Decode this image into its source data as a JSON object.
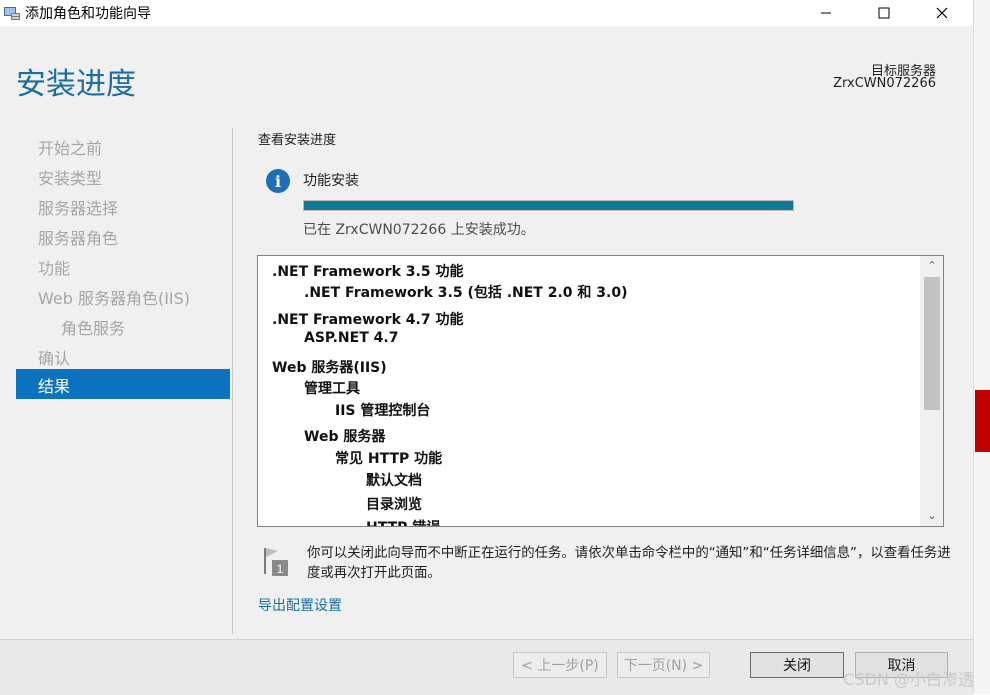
{
  "window": {
    "title": "添加角色和功能向导",
    "controls": [
      "minimize",
      "maximize",
      "close"
    ]
  },
  "header": {
    "page_title": "安装进度",
    "target_label": "目标服务器",
    "target_name": "ZrxCWN072266"
  },
  "nav": {
    "items": [
      {
        "label": "开始之前"
      },
      {
        "label": "安装类型"
      },
      {
        "label": "服务器选择"
      },
      {
        "label": "服务器角色"
      },
      {
        "label": "功能"
      },
      {
        "label": "Web 服务器角色(IIS)"
      },
      {
        "label": "角色服务"
      },
      {
        "label": "确认"
      },
      {
        "label": "结果"
      }
    ],
    "active_index": 8
  },
  "main": {
    "section_title": "查看安装进度",
    "feature_label": "功能安装",
    "progress_fraction": 1.0,
    "status_text": "已在 ZrxCWN072266 上安装成功。",
    "results": [
      {
        "text": ".NET Framework 3.5 功能",
        "level": 0
      },
      {
        "text": ".NET Framework 3.5 (包括 .NET 2.0 和 3.0)",
        "level": 1
      },
      {
        "text": ".NET Framework 4.7 功能",
        "level": 0
      },
      {
        "text": "ASP.NET 4.7",
        "level": 1
      },
      {
        "text": "Web 服务器(IIS)",
        "level": 0
      },
      {
        "text": "管理工具",
        "level": 1
      },
      {
        "text": "IIS 管理控制台",
        "level": 2
      },
      {
        "text": "Web 服务器",
        "level": 1
      },
      {
        "text": "常见 HTTP 功能",
        "level": 2
      },
      {
        "text": "默认文档",
        "level": 3
      },
      {
        "text": "目录浏览",
        "level": 3
      },
      {
        "text": "HTTP 错误",
        "level": 3
      }
    ],
    "note_text": "你可以关闭此向导而不中断正在运行的任务。请依次单击命令栏中的“通知”和“任务详细信息”，以查看任务进度或再次打开此页面。",
    "export_link": "导出配置设置"
  },
  "footer": {
    "prev_label": "< 上一步(P)",
    "next_label": "下一页(N) >",
    "close_label": "关闭",
    "cancel_label": "取消"
  },
  "watermark": "CSDN @小白渗透",
  "colors": {
    "title_blue": "#1a6ea0",
    "nav_active": "#0e73bf",
    "progress": "#0f7a91",
    "info_icon": "#1f6fb8"
  }
}
